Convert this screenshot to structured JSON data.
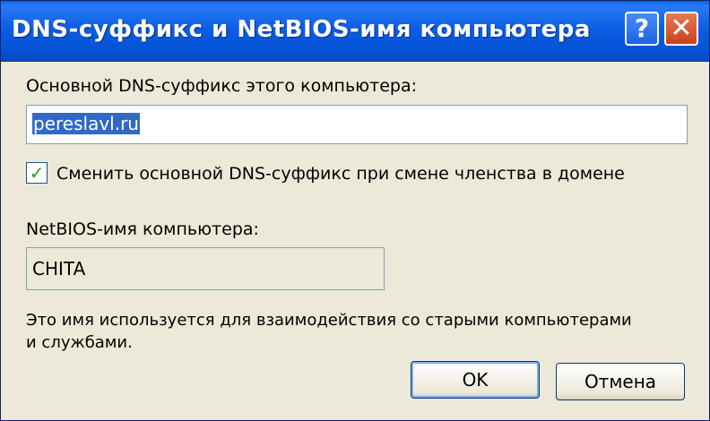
{
  "dialog": {
    "title": "DNS-суффикс и NetBIOS-имя компьютера",
    "help_button": "?",
    "close_button": "✕"
  },
  "suffix": {
    "label": "Основной DNS-суффикс этого компьютера:",
    "value": "pereslavl.ru"
  },
  "checkbox": {
    "checked": true,
    "label": "Сменить основной DNS-суффикс при смене членства в домене"
  },
  "netbios": {
    "label": "NetBIOS-имя компьютера:",
    "value": "CHITA"
  },
  "note": {
    "line1": "Это имя используется для взаимодействия со старыми компьютерами",
    "line2": "и службами."
  },
  "buttons": {
    "ok": "OK",
    "cancel": "Отмена"
  }
}
